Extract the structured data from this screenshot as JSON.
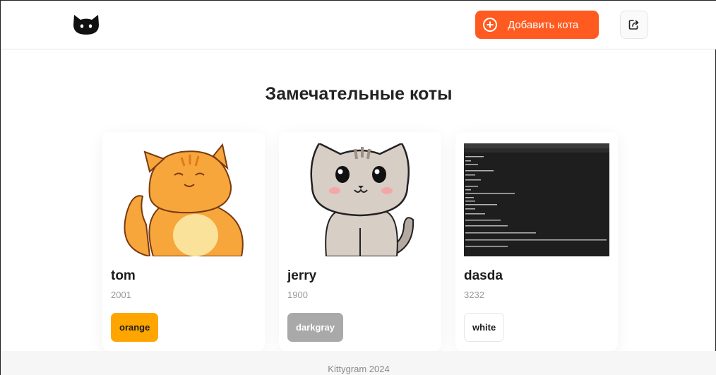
{
  "header": {
    "logo_icon": "cat-logo-icon",
    "add_button_label": "Добавить кота",
    "add_button_icon": "plus-circle-icon",
    "logout_icon": "logout-icon",
    "accent_color": "#ff5a1f"
  },
  "main": {
    "title": "Замечательные коты",
    "cats": [
      {
        "name": "tom",
        "year": "2001",
        "color": "orange",
        "color_hex": "#ffa500",
        "image": "orange-cat-illustration"
      },
      {
        "name": "jerry",
        "year": "1900",
        "color": "darkgray",
        "color_hex": "#a9a9a9",
        "image": "gray-cat-illustration"
      },
      {
        "name": "dasda",
        "year": "3232",
        "color": "white",
        "color_hex": "#ffffff",
        "image": "code-editor-screenshot"
      }
    ]
  },
  "footer": {
    "text": "Kittygram 2024"
  }
}
